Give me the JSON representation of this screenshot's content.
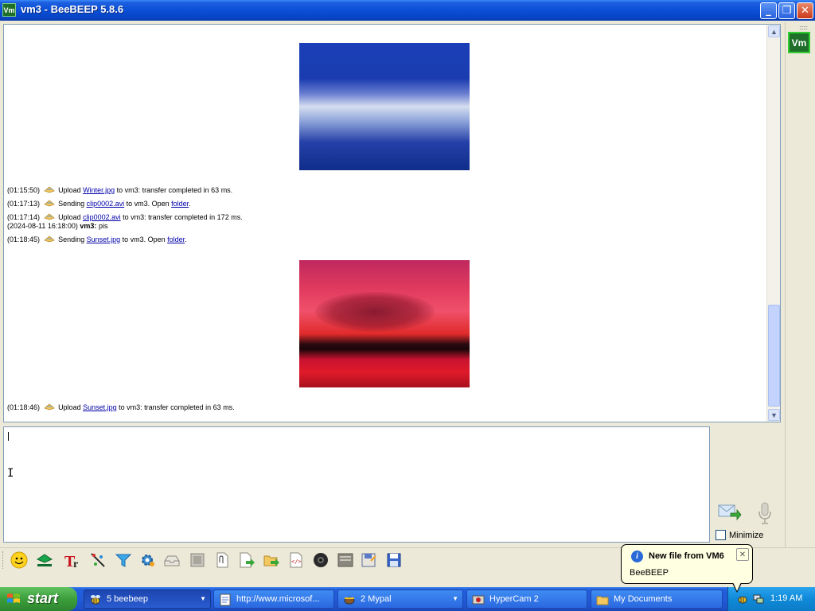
{
  "window": {
    "title": "vm3 - BeeBEEP 5.8.6",
    "icon_label": "Vm",
    "controls": {
      "minimize": "_",
      "maximize": "❐",
      "close": "✕"
    }
  },
  "chat": {
    "images": [
      {
        "name": "Winter.jpg",
        "subject": "snow-covered forest, blue tones"
      },
      {
        "name": "Sunset.jpg",
        "subject": "red sunset over water"
      }
    ],
    "messages": [
      {
        "time": "(01:15:50)",
        "pre": "Upload ",
        "link": "Winter.jpg",
        "post": " to vm3: transfer completed in 63 ms."
      },
      {
        "time": "(01:17:13)",
        "pre": "Sending ",
        "link": "clip0002.avi",
        "post": " to vm3. Open ",
        "link2": "folder",
        "post2": "."
      },
      {
        "time": "(01:17:14)",
        "pre": "Upload ",
        "link": "clip0002.avi",
        "post": " to vm3: transfer completed in 172 ms."
      },
      {
        "time": "(2024-08-11 16:18:00)",
        "sender": "vm3:",
        "text": " pis"
      },
      {
        "time": "(01:18:45)",
        "pre": "Sending ",
        "link": "Sunset.jpg",
        "post": " to vm3. Open ",
        "link2": "folder",
        "post2": "."
      },
      {
        "time": "(01:18:46)",
        "pre": "Upload ",
        "link": "Sunset.jpg",
        "post": " to vm3: transfer completed in 63 ms."
      }
    ]
  },
  "compose": {
    "value": "",
    "minimize_label": "Minimize",
    "minimize_checked": false
  },
  "users": [
    {
      "label": "Vm",
      "color": "#1f6f2a"
    }
  ],
  "toolbar": {
    "icons": [
      "emoticon-icon",
      "underline-green-icon",
      "font-icon",
      "color-picker-icon",
      "filter-icon",
      "settings-gear-icon",
      "inbox-icon",
      "screenshot-icon",
      "attach-file-icon",
      "send-file-icon",
      "send-folder-icon",
      "html-code-icon",
      "webcam-icon",
      "clear-icon",
      "save-icon",
      "save-chat-icon"
    ]
  },
  "taskbar": {
    "start_label": "start",
    "tasks": [
      {
        "label": "5 beebeep",
        "active": true,
        "dropdown": true
      },
      {
        "label": "http://www.microsof...",
        "active": false,
        "dropdown": false
      },
      {
        "label": "2 Mypal",
        "active": false,
        "dropdown": true
      },
      {
        "label": "HyperCam 2",
        "active": false,
        "dropdown": false
      },
      {
        "label": "My Documents",
        "active": false,
        "dropdown": false
      }
    ],
    "clock": "1:19 AM"
  },
  "balloon": {
    "title": "New file from VM6",
    "body": "BeeBEEP",
    "close": "✕"
  }
}
